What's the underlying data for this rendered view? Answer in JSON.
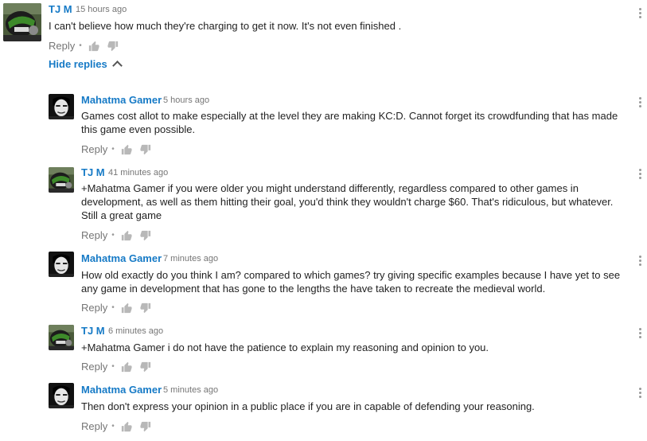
{
  "comments": [
    {
      "author": "TJ M",
      "time": "15 hours ago",
      "text": "I can't believe how much they're charging to get it now. It's not even finished .",
      "reply": "Reply",
      "avatar": "tjm"
    },
    {
      "author": "Mahatma Gamer",
      "time": "5 hours ago",
      "text": "Games cost allot to make especially at the level they are making KC:D. Cannot forget its crowdfunding that has made this game even possible.",
      "reply": "Reply",
      "avatar": "mahatma"
    },
    {
      "author": "TJ M",
      "time": "41 minutes ago",
      "text": "+Mahatma Gamer if you were older you might understand differently, regardless compared to other games in development, as well as them hitting their goal, you'd think they wouldn't charge $60. That's ridiculous, but whatever. Still a great game",
      "reply": "Reply",
      "avatar": "tjm"
    },
    {
      "author": "Mahatma Gamer",
      "time": "7 minutes ago",
      "text": "How old exactly do you think I am? compared to which games? try giving specific examples because I have yet to see any game in development that has gone to the lengths the have taken to recreate the medieval world.",
      "reply": "Reply",
      "avatar": "mahatma"
    },
    {
      "author": "TJ M",
      "time": "6 minutes ago",
      "text": "+Mahatma Gamer i do not have the patience to explain my reasoning and opinion to you.",
      "reply": "Reply",
      "avatar": "tjm"
    },
    {
      "author": "Mahatma Gamer",
      "time": "5 minutes ago",
      "text": "Then don't express your opinion in a public place if you are in capable of defending your reasoning.",
      "reply": "Reply",
      "avatar": "mahatma"
    }
  ],
  "hide_replies": "Hide replies",
  "icons": {
    "like": "thumb-up-icon",
    "dislike": "thumb-down-icon",
    "menu": "more-vert-icon",
    "chevron": "chevron-up-icon"
  },
  "colors": {
    "author": "#167ac6",
    "meta": "#767676",
    "text": "#222222"
  }
}
